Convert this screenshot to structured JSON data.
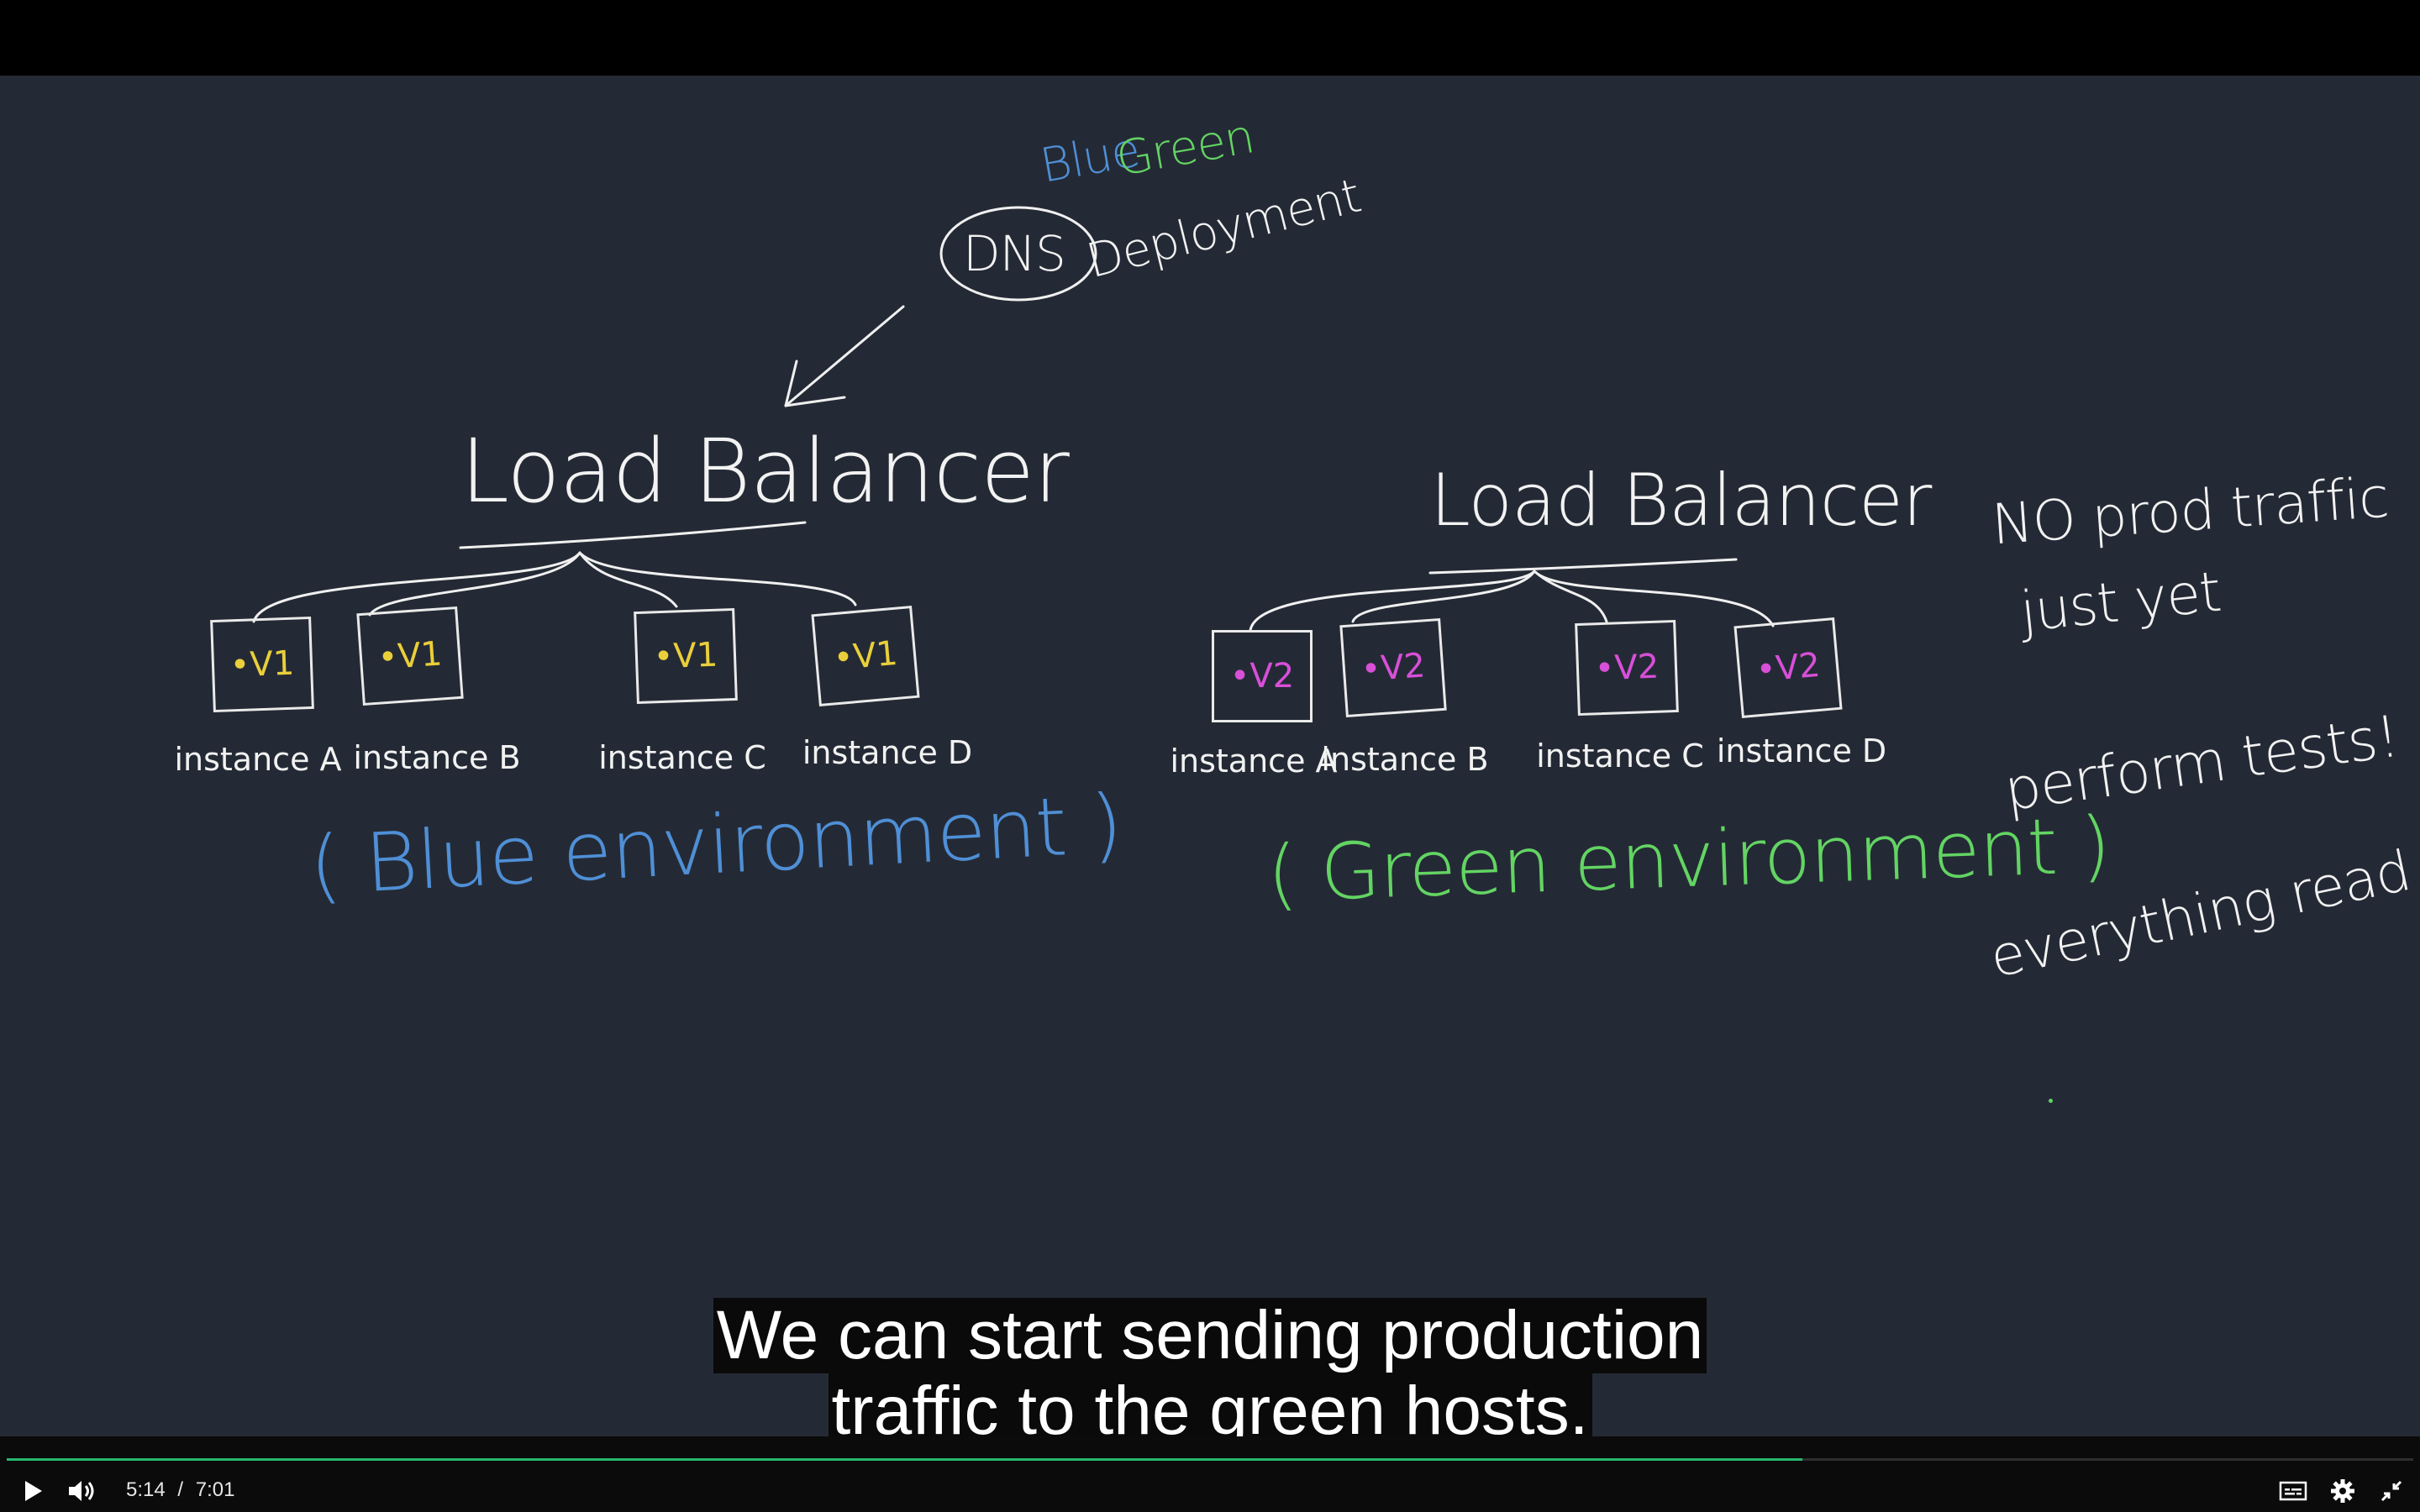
{
  "player": {
    "progress": 0.746,
    "buffered": 0.74,
    "current_time": "5:14",
    "time_separator": "/",
    "duration": "7:01",
    "colors": {
      "progress": "#27b86e",
      "background": "#242a35"
    }
  },
  "whiteboard": {
    "dns_label": "DNS",
    "title_blue": "Blue",
    "title_green": "Green",
    "title_deploy": "Deployment",
    "lb_left": "Load Balancer",
    "lb_right": "Load Balancer",
    "blue_env": {
      "text": "( Blue environment )",
      "instances": [
        {
          "version": "•V1",
          "label": "instance A"
        },
        {
          "version": "•V1",
          "label": "instance B"
        },
        {
          "version": "•V1",
          "label": "instance C"
        },
        {
          "version": "•V1",
          "label": "instance D"
        }
      ]
    },
    "green_env": {
      "text": "( Green environment )",
      "instances": [
        {
          "version": "•V2",
          "label": "instance A"
        },
        {
          "version": "•V2",
          "label": "instance B"
        },
        {
          "version": "•V2",
          "label": "instance C"
        },
        {
          "version": "•V2",
          "label": "instance D"
        }
      ]
    },
    "notes": {
      "line1": "NO prod traffic",
      "line2": "just yet",
      "line3": "perform tests!",
      "line4": "everything read"
    }
  },
  "captions": {
    "line1": "We can start sending production",
    "line2": "traffic to the green hosts."
  },
  "icons": {
    "play": "play-icon",
    "volume": "volume-icon",
    "captions": "captions-icon",
    "settings": "gear-icon",
    "exit_fullscreen": "exit-fullscreen-icon"
  }
}
